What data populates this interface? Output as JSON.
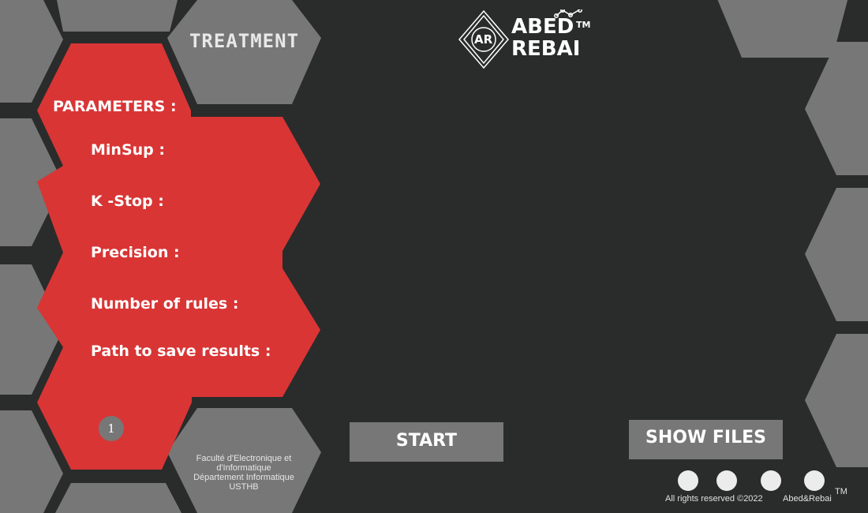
{
  "header": {
    "tab_title": "TREATMENT",
    "logo_mark": "AR",
    "logo_line1": "ABED",
    "logo_line2": "REBAI",
    "trademark": "TM"
  },
  "parameters": {
    "title": "PARAMETERS :",
    "items": [
      {
        "label": "MinSup :"
      },
      {
        "label": "K -Stop :"
      },
      {
        "label": "Precision :"
      },
      {
        "label": "Number of rules :"
      },
      {
        "label": "Path to save results :"
      }
    ]
  },
  "step_badge": "1",
  "faculty": {
    "line1": "Faculté d'Electronique et",
    "line2": "d'Informatique",
    "line3": "Département Informatique",
    "line4": "USTHB"
  },
  "buttons": {
    "start": "START",
    "show_files": "SHOW FILES"
  },
  "footer": {
    "rights": "All rights reserved ©2022",
    "brand": "Abed&Rebai",
    "trademark": "TM"
  },
  "colors": {
    "background": "#2a2b2b",
    "hexagon_gray": "#777777",
    "accent_red": "#d93535",
    "text": "#ffffff"
  },
  "icons": [
    "logo-diamond-icon",
    "trend-line-icon"
  ]
}
